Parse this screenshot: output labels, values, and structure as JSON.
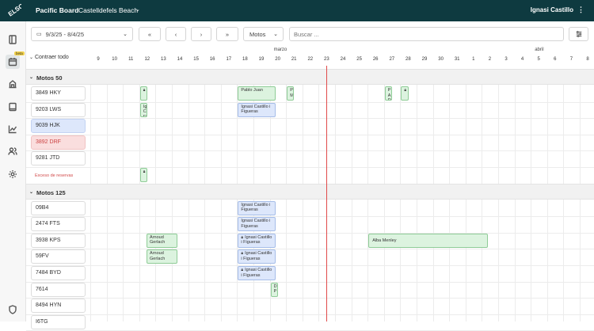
{
  "app": {
    "board_title": "Pacific Board",
    "location": "Castelldefels Beach",
    "user_name": "Ignasi Castillo",
    "logo_text": "ELSO",
    "beta_badge": "beta"
  },
  "sidebar_icons": [
    "panel-icon",
    "calendar-icon",
    "building-icon",
    "book-icon",
    "chart-icon",
    "users-icon",
    "gear-icon",
    "shield-icon"
  ],
  "toolbar": {
    "date_range": "9/3/25 - 8/4/25",
    "first_label": "«",
    "prev_label": "‹",
    "next_label": "›",
    "last_label": "»",
    "category": "Motos",
    "search_placeholder": "Buscar ..."
  },
  "calendar": {
    "collapse_label": "Contraer todo",
    "months": [
      {
        "label": "marzo",
        "day_index": 11
      },
      {
        "label": "abril",
        "day_index": 27
      }
    ],
    "days": [
      "9",
      "10",
      "11",
      "12",
      "13",
      "14",
      "15",
      "16",
      "17",
      "18",
      "19",
      "20",
      "21",
      "22",
      "23",
      "24",
      "25",
      "26",
      "27",
      "28",
      "29",
      "30",
      "31",
      "1",
      "2",
      "3",
      "4",
      "5",
      "6",
      "7",
      "8"
    ],
    "today_index": 14
  },
  "groups": [
    {
      "name": "Motos 50",
      "rows": [
        {
          "label": "3849 HKY",
          "style": "normal"
        },
        {
          "label": "9203 LWS",
          "style": "normal"
        },
        {
          "label": "9039 HJK",
          "style": "blue"
        },
        {
          "label": "3892 DRF",
          "style": "red"
        },
        {
          "label": "9281 JTD",
          "style": "normal"
        },
        {
          "label": "Exceso de reservas",
          "style": "overbook"
        }
      ]
    },
    {
      "name": "Motos 125",
      "rows": [
        {
          "label": "09B4",
          "style": "normal"
        },
        {
          "label": "2474 FTS",
          "style": "normal"
        },
        {
          "label": "3938 KPS",
          "style": "normal"
        },
        {
          "label": "59FV",
          "style": "normal"
        },
        {
          "label": "7484 BYD",
          "style": "normal"
        },
        {
          "label": "7614",
          "style": "normal"
        },
        {
          "label": "8494 HYN",
          "style": "normal"
        },
        {
          "label": "I6TG",
          "style": "normal"
        }
      ]
    }
  ],
  "bookings": [
    {
      "group": 0,
      "row": 0,
      "start": 3,
      "span": 0.45,
      "color": "green",
      "lock": true,
      "text": ""
    },
    {
      "group": 0,
      "row": 0,
      "start": 9,
      "span": 2.3,
      "color": "green",
      "lock": false,
      "text": "Pablo Juan"
    },
    {
      "group": 0,
      "row": 0,
      "start": 12,
      "span": 0.45,
      "color": "green",
      "lock": false,
      "text": "P M"
    },
    {
      "group": 0,
      "row": 0,
      "start": 18,
      "span": 0.45,
      "color": "green",
      "lock": false,
      "text": "P A D"
    },
    {
      "group": 0,
      "row": 0,
      "start": 19,
      "span": 0.45,
      "color": "green",
      "lock": true,
      "text": ""
    },
    {
      "group": 0,
      "row": 1,
      "start": 3,
      "span": 0.45,
      "color": "green",
      "lock": false,
      "text": "Ig C Fi"
    },
    {
      "group": 0,
      "row": 1,
      "start": 9,
      "span": 2.3,
      "color": "blue",
      "lock": false,
      "text": "Ignasi Castillo i Figueras"
    },
    {
      "group": 0,
      "row": 5,
      "start": 3,
      "span": 0.45,
      "color": "green",
      "lock": true,
      "text": ""
    },
    {
      "group": 1,
      "row": 0,
      "start": 9,
      "span": 2.3,
      "color": "blue",
      "lock": false,
      "text": "Ignasi Castillo i Figueras"
    },
    {
      "group": 1,
      "row": 1,
      "start": 9,
      "span": 2.3,
      "color": "blue",
      "lock": false,
      "text": "Ignasi Castillo i Figueras"
    },
    {
      "group": 1,
      "row": 2,
      "start": 3.4,
      "span": 1.9,
      "color": "green",
      "lock": false,
      "text": "Arnoud Gerlach"
    },
    {
      "group": 1,
      "row": 2,
      "start": 9,
      "span": 2.3,
      "color": "blue",
      "lock": true,
      "text": "Ignasi Castillo i Figueras"
    },
    {
      "group": 1,
      "row": 2,
      "start": 17,
      "span": 7.3,
      "color": "green",
      "lock": false,
      "text": "Alba Menley"
    },
    {
      "group": 1,
      "row": 3,
      "start": 3.4,
      "span": 1.9,
      "color": "green",
      "lock": false,
      "text": "Arnoud Gerlach"
    },
    {
      "group": 1,
      "row": 3,
      "start": 9,
      "span": 2.3,
      "color": "blue",
      "lock": true,
      "text": "Ignasi Castillo i Figueras"
    },
    {
      "group": 1,
      "row": 4,
      "start": 9,
      "span": 2.3,
      "color": "blue",
      "lock": true,
      "text": "Ignasi Castillo i Figueras"
    },
    {
      "group": 1,
      "row": 5,
      "start": 11,
      "span": 0.45,
      "color": "green",
      "lock": false,
      "text": "D P"
    }
  ]
}
